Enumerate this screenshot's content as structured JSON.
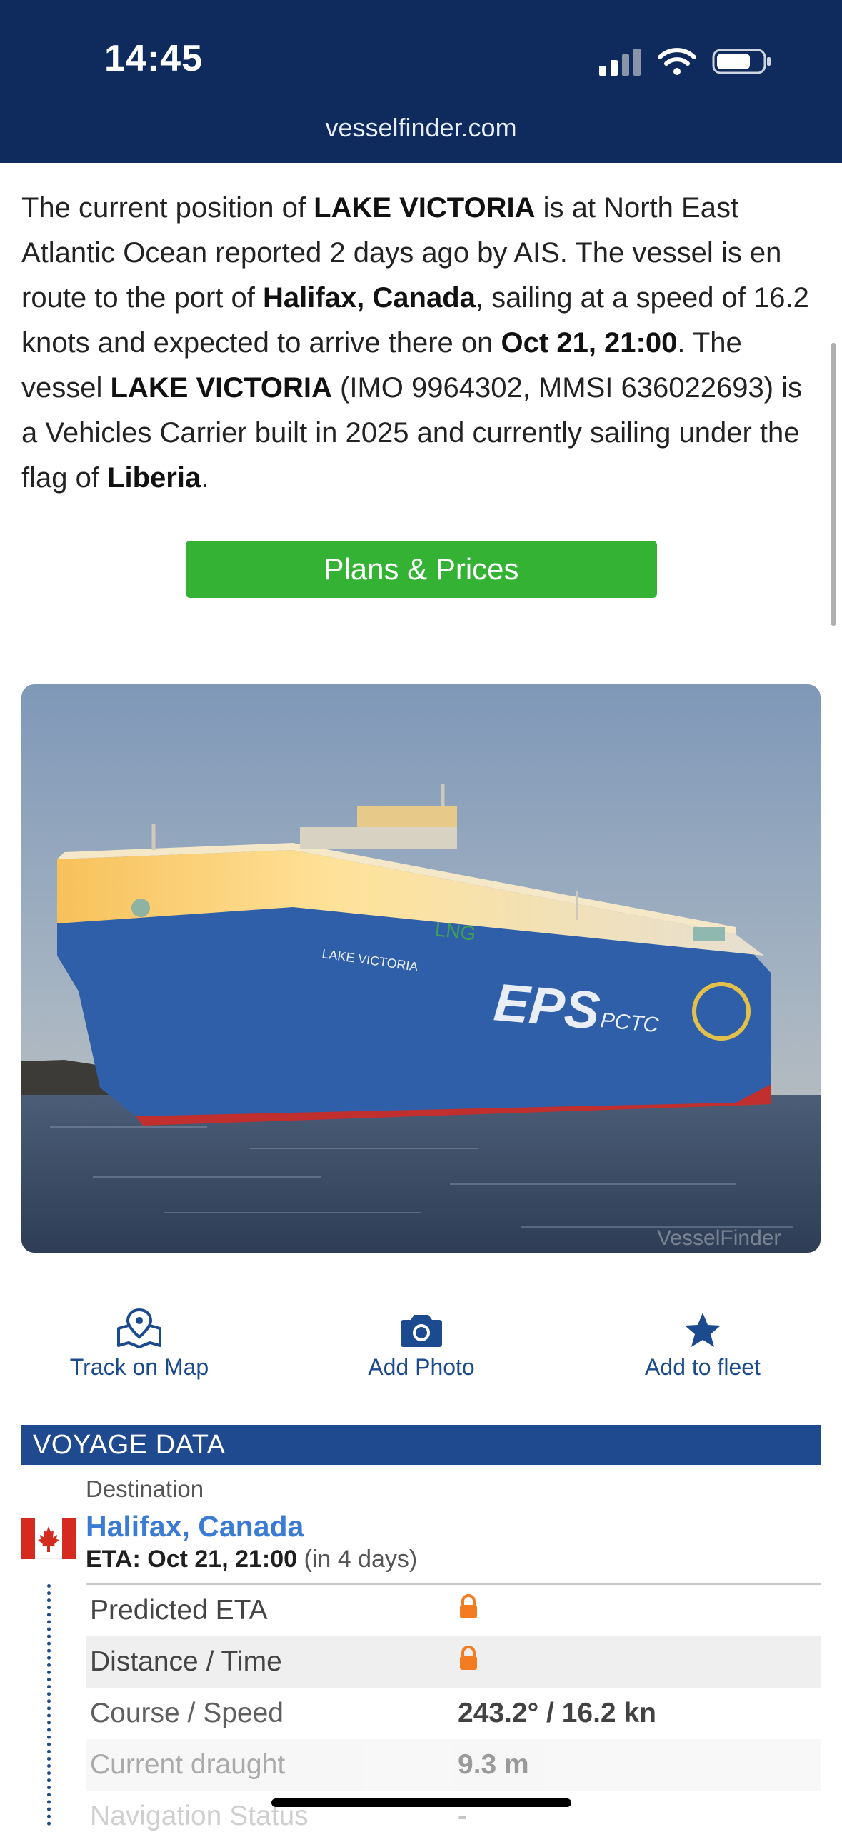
{
  "status_bar": {
    "time": "14:45"
  },
  "browser": {
    "url": "vesselfinder.com"
  },
  "description": {
    "t1": "The current position of ",
    "vessel1": "LAKE VICTORIA",
    "t2": " is at North East Atlantic Ocean reported 2 days ago by AIS. The vessel is en route to the port of ",
    "port": "Halifax, Canada",
    "t3": ", sailing at a speed of 16.2 knots and expected to arrive there on ",
    "eta": "Oct 21, 21:00",
    "t4": ". The vessel ",
    "vessel2": "LAKE VICTORIA",
    "t5": " (IMO 9964302, MMSI 636022693) is a Vehicles Carrier built in 2025 and currently sailing under the flag of ",
    "flag": "Liberia",
    "t6": "."
  },
  "plans_button": "Plans & Prices",
  "photo": {
    "hull_name": "LAKE VICTORIA",
    "livery": "EPS",
    "livery_sub": "PCTC",
    "fuel": "LNG",
    "watermark": "VesselFinder"
  },
  "actions": [
    {
      "label": "Track on Map",
      "icon": "map-pin-icon"
    },
    {
      "label": "Add Photo",
      "icon": "camera-icon"
    },
    {
      "label": "Add to fleet",
      "icon": "star-icon"
    }
  ],
  "voyage": {
    "header": "VOYAGE DATA",
    "destination_label": "Destination",
    "destination": "Halifax, Canada",
    "eta_label": "ETA: Oct 21, 21:00",
    "eta_relative": "(in 4 days)",
    "rows": [
      {
        "key": "Predicted ETA",
        "value": "",
        "locked": true
      },
      {
        "key": "Distance / Time",
        "value": "",
        "locked": true
      },
      {
        "key": "Course / Speed",
        "value": "243.2° / 16.2 kn",
        "locked": false
      },
      {
        "key": "Current draught",
        "value": "9.3 m",
        "locked": false
      },
      {
        "key": "Navigation Status",
        "value": "-",
        "locked": false
      }
    ]
  },
  "colors": {
    "header_bg": "#0f2a5c",
    "accent": "#1f4a8f",
    "button_green": "#34b233",
    "link_blue": "#3a7bd5",
    "lock_orange": "#f47c20"
  }
}
